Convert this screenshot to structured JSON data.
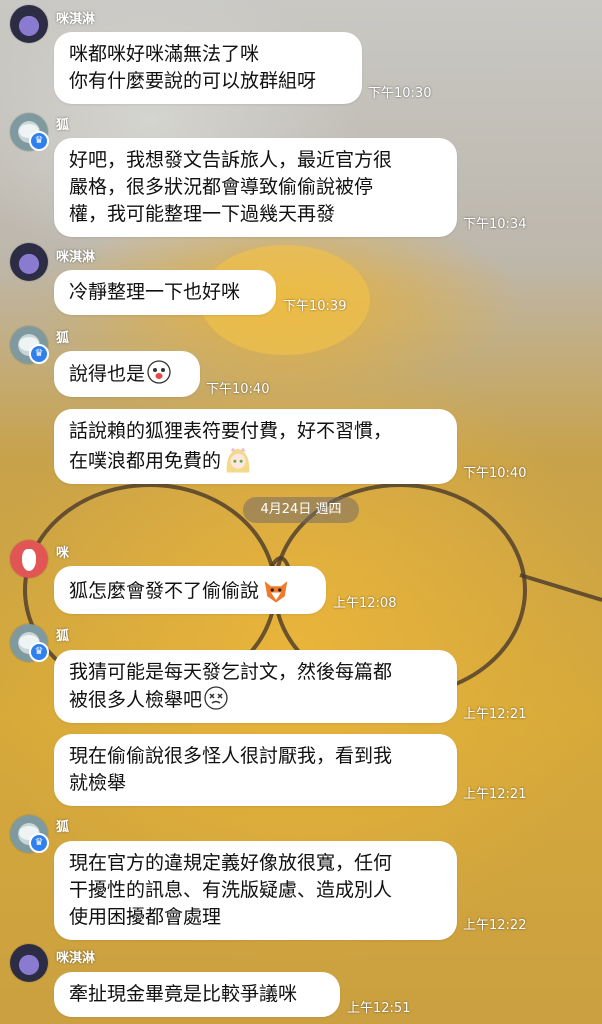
{
  "messages": [
    {
      "sender": "咪淇淋",
      "lines": [
        "咪都咪好咪滿無法了咪",
        "你有什麼要說的可以放群組呀"
      ],
      "time": "下午10:30"
    },
    {
      "sender": "狐",
      "lines": [
        "好吧，我想發文告訴旅人，最近官方很",
        "嚴格，很多狀況都會導致偷偷說被停",
        "權，我可能整理一下過幾天再發"
      ],
      "time": "下午10:34"
    },
    {
      "sender": "咪淇淋",
      "lines": [
        "冷靜整理一下也好咪"
      ],
      "time": "下午10:39"
    },
    {
      "sender": "狐",
      "lines": [
        "說得也是"
      ],
      "time": "下午10:40"
    },
    {
      "lines": [
        "話說賴的狐狸表符要付費，好不習慣，",
        "在噗浪都用免費的"
      ],
      "time": "下午10:40"
    },
    {
      "sender": "咪",
      "lines": [
        "狐怎麼會發不了偷偷說"
      ],
      "time": "上午12:08"
    },
    {
      "sender": "狐",
      "lines": [
        "我猜可能是每天發乞討文，然後每篇都",
        "被很多人檢舉吧"
      ],
      "time": "上午12:21"
    },
    {
      "lines": [
        "現在偷偷說很多怪人很討厭我，看到我",
        "就檢舉"
      ],
      "time": "上午12:21"
    },
    {
      "sender": "狐",
      "lines": [
        "現在官方的違規定義好像放很寬，任何",
        "干擾性的訊息、有洗版疑慮、造成別人",
        "使用困擾都會處理"
      ],
      "time": "上午12:22"
    },
    {
      "sender": "咪淇淋",
      "lines": [
        "牽扯現金畢竟是比較爭議咪"
      ],
      "time": "上午12:51"
    }
  ],
  "date_separator": "4月24日 週四",
  "icons": [
    "avatar-mi",
    "avatar-fox",
    "crown-badge-icon",
    "avatar-dog",
    "surprised-emoji-icon",
    "anime-girl-sticker-icon",
    "fox-sticker-icon",
    "dizzy-emoji-icon"
  ],
  "colors": {
    "bubble": "#ffffff",
    "text": "#111111",
    "badge": "#2f7ff0"
  }
}
